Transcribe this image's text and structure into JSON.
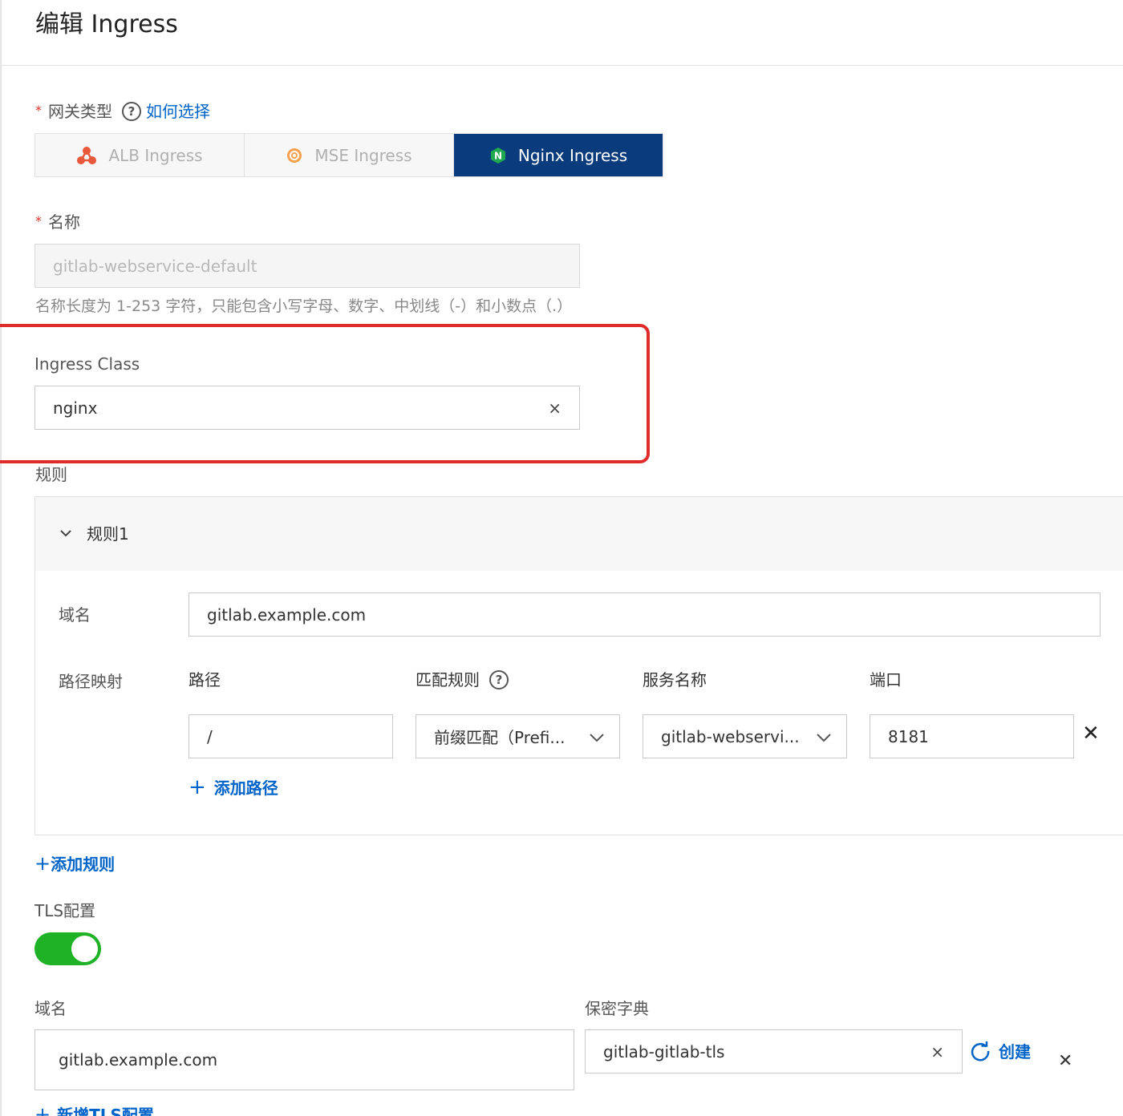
{
  "page": {
    "title": "编辑 Ingress"
  },
  "gateway": {
    "label": "网关类型",
    "help_link": "如何选择",
    "options": [
      "ALB Ingress",
      "MSE Ingress",
      "Nginx Ingress"
    ],
    "selected": "Nginx Ingress",
    "nginx_icon_letter": "N"
  },
  "name": {
    "label": "名称",
    "value": "gitlab-webservice-default",
    "hint": "名称长度为 1-253 字符，只能包含小写字母、数字、中划线（-）和小数点（.）"
  },
  "ingress_class": {
    "label": "Ingress Class",
    "value": "nginx",
    "clear": "×"
  },
  "rules": {
    "label": "规则",
    "rule1": {
      "title": "规则1",
      "domain_label": "域名",
      "domain_value": "gitlab.example.com",
      "path_mapping_label": "路径映射",
      "col_path": "路径",
      "col_match": "匹配规则",
      "col_service": "服务名称",
      "col_port": "端口",
      "path_value": "/",
      "match_value": "前缀匹配（Prefi...",
      "service_value": "gitlab-webservi...",
      "port_value": "8181",
      "remove": "✕",
      "add_path": "添加路径"
    },
    "add_rule": "添加规则"
  },
  "tls": {
    "label": "TLS配置",
    "enabled": true,
    "domain_label": "域名",
    "domain_value": "gitlab.example.com",
    "secret_label": "保密字典",
    "secret_value": "gitlab-gitlab-tls",
    "secret_clear": "×",
    "create": "创建",
    "remove": "✕",
    "add_tls": "新增TLS配置"
  },
  "colors": {
    "accent": "#0064c8",
    "active_tab": "#0a3c7d",
    "toggle_on": "#1fb227",
    "highlight_box": "#e02b2b"
  }
}
